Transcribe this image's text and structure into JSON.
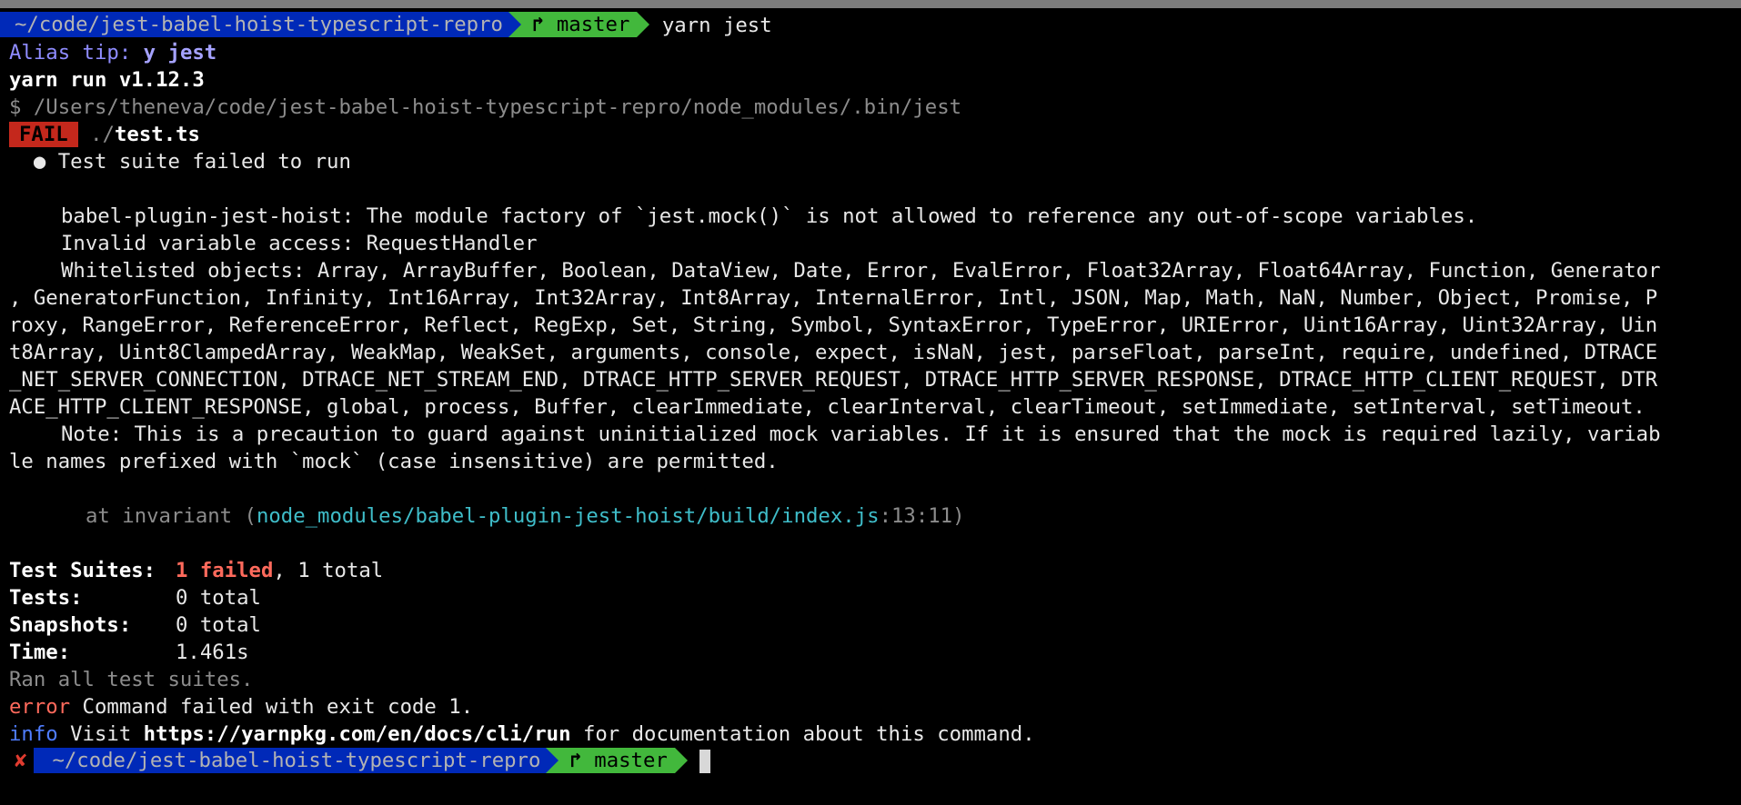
{
  "prompt1": {
    "path": "~/code/jest-babel-hoist-typescript-repro",
    "branch_icon": "git-branch-icon",
    "branch_glyph": "↱",
    "branch": "master",
    "command": "yarn jest"
  },
  "alias_tip": {
    "label": "Alias tip: ",
    "alias": "y jest"
  },
  "yarn_run": "yarn run v1.12.3",
  "exec_line": "$ /Users/theneva/code/jest-babel-hoist-typescript-repro/node_modules/.bin/jest",
  "result": {
    "badge": "FAIL",
    "prefix": "./",
    "file": "test.ts"
  },
  "suite_failed": "  ● Test suite failed to run",
  "error_lines": [
    "babel-plugin-jest-hoist: The module factory of `jest.mock()` is not allowed to reference any out-of-scope variables.",
    "Invalid variable access: RequestHandler",
    "Whitelisted objects: Array, ArrayBuffer, Boolean, DataView, Date, Error, EvalError, Float32Array, Float64Array, Function, Generator",
    ", GeneratorFunction, Infinity, Int16Array, Int32Array, Int8Array, InternalError, Intl, JSON, Map, Math, NaN, Number, Object, Promise, P",
    "roxy, RangeError, ReferenceError, Reflect, RegExp, Set, String, Symbol, SyntaxError, TypeError, URIError, Uint16Array, Uint32Array, Uin",
    "t8Array, Uint8ClampedArray, WeakMap, WeakSet, arguments, console, expect, isNaN, jest, parseFloat, parseInt, require, undefined, DTRACE",
    "_NET_SERVER_CONNECTION, DTRACE_NET_STREAM_END, DTRACE_HTTP_SERVER_REQUEST, DTRACE_HTTP_SERVER_RESPONSE, DTRACE_HTTP_CLIENT_REQUEST, DTR",
    "ACE_HTTP_CLIENT_RESPONSE, global, process, Buffer, clearImmediate, clearInterval, clearTimeout, setImmediate, setInterval, setTimeout.",
    "Note: This is a precaution to guard against uninitialized mock variables. If it is ensured that the mock is required lazily, variab",
    "le names prefixed with `mock` (case insensitive) are permitted."
  ],
  "stack": {
    "prefix": "at invariant (",
    "path": "node_modules/babel-plugin-jest-hoist/build/index.js",
    "loc": ":13:11",
    "suffix": ")"
  },
  "summary": {
    "suites_label": "Test Suites:",
    "suites_failed": "1 failed",
    "suites_rest": ", 1 total",
    "tests_label": "Tests:",
    "tests_value": "0 total",
    "snapshots_label": "Snapshots:",
    "snapshots_value": "0 total",
    "time_label": "Time:",
    "time_value": "1.461s"
  },
  "ran_all": "Ran all test suites.",
  "error_msg": {
    "tag": "error",
    "text": " Command failed with exit code 1."
  },
  "info_msg": {
    "tag": "info",
    "pre": " Visit ",
    "url": "https://yarnpkg.com/en/docs/cli/run",
    "post": " for documentation about this command."
  },
  "prompt2": {
    "status_icon": "cross-icon",
    "status_glyph": "✘",
    "path": "~/code/jest-babel-hoist-typescript-repro",
    "branch_icon": "git-branch-icon",
    "branch_glyph": "↱",
    "branch": "master"
  },
  "colors": {
    "path_bg": "#0029b8",
    "branch_bg": "#42b83c",
    "fail_bg": "#c4281c",
    "error": "#ff6a5c",
    "link": "#3fbdc9"
  }
}
